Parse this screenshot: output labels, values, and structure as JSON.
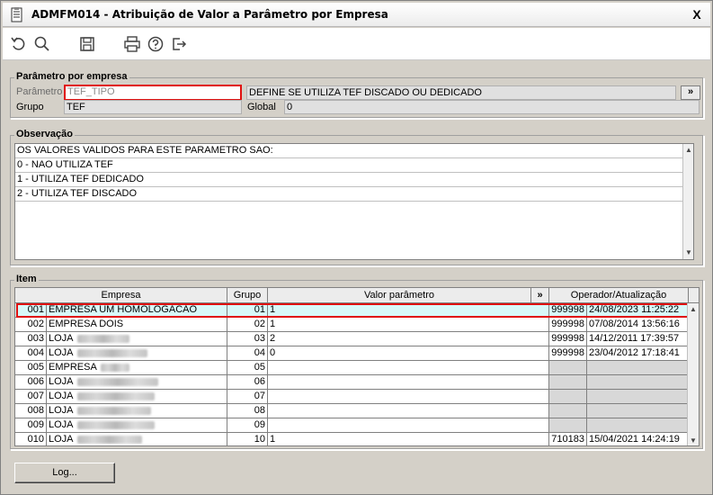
{
  "window": {
    "title": "ADMFM014 - Atribuição de Valor a Parâmetro por Empresa",
    "close_label": "X"
  },
  "toolbar": {
    "items": [
      "undo-icon",
      "search-icon",
      "save-icon",
      "print-icon",
      "help-icon",
      "exit-icon"
    ]
  },
  "param_section": {
    "legend": "Parâmetro por empresa",
    "parametro_label": "Parâmetro",
    "parametro_value": "TEF_TIPO",
    "description": "DEFINE SE UTILIZA TEF DISCADO OU DEDICADO",
    "expand_label": "»",
    "grupo_label": "Grupo",
    "grupo_value": "TEF",
    "global_label": "Global",
    "global_value": "0"
  },
  "observacao": {
    "legend": "Observação",
    "lines": [
      "OS VALORES VALIDOS PARA ESTE PARAMETRO SAO:",
      "0 - NAO UTILIZA TEF",
      "1 - UTILIZA TEF DEDICADO",
      "2 - UTILIZA TEF DISCADO"
    ]
  },
  "item": {
    "legend": "Item",
    "columns": {
      "empresa": "Empresa",
      "grupo": "Grupo",
      "valor": "Valor parâmetro",
      "expand": "»",
      "operador": "Operador/Atualização"
    },
    "rows": [
      {
        "code": "001",
        "name": "EMPRESA UM HOMOLOGACAO",
        "grupo": "01",
        "valor": "1",
        "operador": "999998",
        "data": "24/08/2023 11:25:22"
      },
      {
        "code": "002",
        "name": "EMPRESA DOIS",
        "grupo": "02",
        "valor": "1",
        "operador": "999998",
        "data": "07/08/2014 13:56:16"
      },
      {
        "code": "003",
        "name": "LOJA",
        "grupo": "03",
        "valor": "2",
        "operador": "999998",
        "data": "14/12/2011 17:39:57"
      },
      {
        "code": "004",
        "name": "LOJA",
        "grupo": "04",
        "valor": "0",
        "operador": "999998",
        "data": "23/04/2012 17:18:41"
      },
      {
        "code": "005",
        "name": "EMPRESA",
        "grupo": "05",
        "valor": "",
        "operador": "",
        "data": ""
      },
      {
        "code": "006",
        "name": "LOJA",
        "grupo": "06",
        "valor": "",
        "operador": "",
        "data": ""
      },
      {
        "code": "007",
        "name": "LOJA",
        "grupo": "07",
        "valor": "",
        "operador": "",
        "data": ""
      },
      {
        "code": "008",
        "name": "LOJA",
        "grupo": "08",
        "valor": "",
        "operador": "",
        "data": ""
      },
      {
        "code": "009",
        "name": "LOJA",
        "grupo": "09",
        "valor": "",
        "operador": "",
        "data": ""
      },
      {
        "code": "010",
        "name": "LOJA",
        "grupo": "10",
        "valor": "1",
        "operador": "710183",
        "data": "15/04/2021 14:24:19"
      }
    ]
  },
  "footer": {
    "log_label": "Log..."
  },
  "colors": {
    "highlight_border": "#e01010",
    "selected_row": "#d8f8f8",
    "window_bg": "#d4d0c8"
  }
}
